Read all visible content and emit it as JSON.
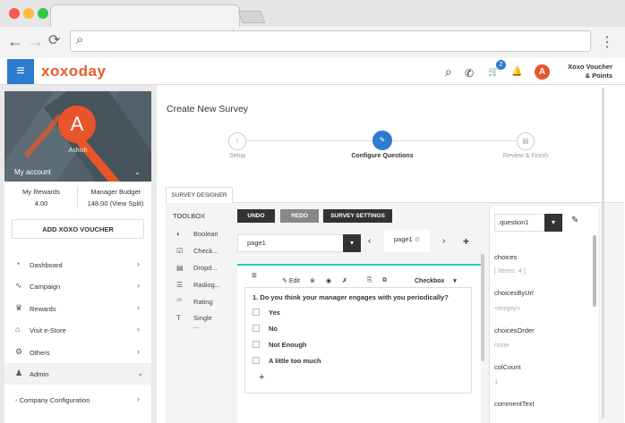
{
  "browser": {
    "menu_glyph": "⋮",
    "back_glyph": "←",
    "forward_glyph": "→",
    "reload_glyph": "⟳",
    "search_glyph": "⌕"
  },
  "header": {
    "menu_glyph": "≡",
    "logo": "xoxoday",
    "cart_count": "2",
    "avatar_initial": "A",
    "user_line1": "Xoxo Voucher",
    "user_line2": "& Points",
    "search_glyph": "⌕",
    "phone_glyph": "✆",
    "cart_glyph": "🛒",
    "bell_glyph": "🔔"
  },
  "profile": {
    "initial": "A",
    "name": "Ashish",
    "my_account": "My account",
    "chevron": "⌄",
    "rewards_label": "My Rewards",
    "rewards_value": "4.00",
    "budget_label": "Manager Budget",
    "budget_value": "148.00",
    "budget_link": "(View Split)"
  },
  "sidebar": {
    "add_voucher": "ADD XOXO VOUCHER",
    "items": [
      {
        "label": "Dashboard",
        "icon": "◔",
        "chev": "›"
      },
      {
        "label": "Campaign",
        "icon": "∿",
        "chev": "›"
      },
      {
        "label": "Rewards",
        "icon": "♛",
        "chev": "›"
      },
      {
        "label": "Visit e-Store",
        "icon": "⌂",
        "chev": "›"
      },
      {
        "label": "Others",
        "icon": "⚙",
        "chev": "›"
      },
      {
        "label": "Admin",
        "icon": "♟",
        "chev": "⌄"
      },
      {
        "label": "- Company Configuration",
        "icon": "",
        "chev": "›"
      }
    ]
  },
  "survey": {
    "title": "Create New Survey",
    "steps": [
      {
        "label": "Setup",
        "icon": "i"
      },
      {
        "label": "Configure Questions",
        "icon": "✎"
      },
      {
        "label": "Review & Finish",
        "icon": "▤"
      }
    ],
    "tab": "SURVEY DESIGNER",
    "toolbox_title": "TOOLBOX",
    "tools": [
      {
        "label": "Boolean",
        "icon": "◐"
      },
      {
        "label": "Check...",
        "icon": "☑"
      },
      {
        "label": "Dropd...",
        "icon": "▤"
      },
      {
        "label": "Radiog...",
        "icon": "☰"
      },
      {
        "label": "Rating",
        "icon": "¹²³"
      },
      {
        "label": "Single ...",
        "icon": "T"
      }
    ],
    "buttons": {
      "undo": "UNDO",
      "redo": "REDO",
      "settings": "SURVEY SETTINGS"
    },
    "page_select": "page1",
    "page_dd": "▾",
    "page_tab": "page1",
    "page_tab_icon": "⚙",
    "prev": "‹",
    "next": "›",
    "add": "+",
    "qtoolbar": {
      "drag": "≡",
      "edit": "Edit",
      "edit_icon": "✎",
      "close_icon": "⊗",
      "eye_icon": "◉",
      "edit2_icon": "✗",
      "copy_icon": "⎘",
      "add_icon": "⧉",
      "type": "Checkbox",
      "type_dd": "▾"
    },
    "question": "1. Do you think your manager engages with you periodically?",
    "options": [
      "Yes",
      "No",
      "Not Enough",
      "A little too much"
    ],
    "add_choice": "+"
  },
  "props": {
    "selected": ".question1",
    "dd": "▾",
    "edit_icon": "✎",
    "items": [
      {
        "name": "choices",
        "value": "[ Items: 4 ]"
      },
      {
        "name": "choicesByUrl",
        "value": "<empty>"
      },
      {
        "name": "choicesOrder",
        "value": "none"
      },
      {
        "name": "colCount",
        "value": "1"
      },
      {
        "name": "commentText",
        "value": ""
      }
    ]
  }
}
